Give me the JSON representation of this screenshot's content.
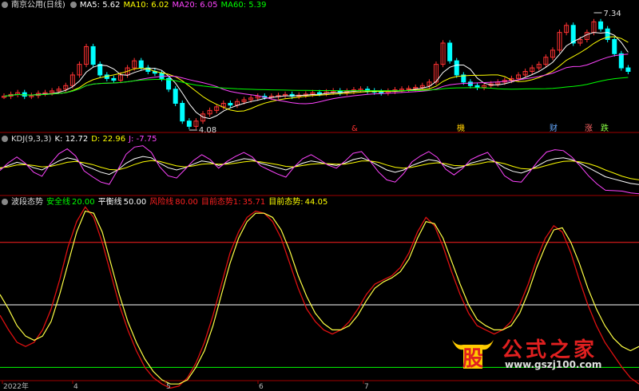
{
  "panel_main": {
    "title": "南京公用(日线)",
    "ma5": {
      "label": "MA5: 5.62",
      "color": "#ffffff"
    },
    "ma10": {
      "label": "MA10: 6.02",
      "color": "#ffff00"
    },
    "ma20": {
      "label": "MA20: 6.05",
      "color": "#ff44ff"
    },
    "ma60": {
      "label": "MA60: 5.39",
      "color": "#00ff00"
    },
    "high_label": "7.34",
    "low_label": "4.08",
    "markers": [
      {
        "text": "&",
        "color": "#ff3030",
        "pos": 0.55
      },
      {
        "text": "機",
        "color": "#ffcc00",
        "pos": 0.715
      },
      {
        "text": "财",
        "color": "#66aaff",
        "pos": 0.86
      },
      {
        "text": "涨",
        "color": "#ff6666",
        "pos": 0.915
      },
      {
        "text": "跌",
        "color": "#88ff44",
        "pos": 0.94
      }
    ]
  },
  "panel_kdj": {
    "title": "KDJ(9,3,3)",
    "k": {
      "label": "K: 12.72",
      "color": "#ffffff"
    },
    "d": {
      "label": "D: 22.96",
      "color": "#ffff00"
    },
    "j": {
      "label": "J: -7.75",
      "color": "#ff44ff"
    }
  },
  "panel_wave": {
    "title": "波段态势",
    "safe": {
      "label": "安全线",
      "value": "20.00",
      "color": "#00ff00"
    },
    "balance": {
      "label": "平衡线",
      "value": "50.00",
      "color": "#ffffff"
    },
    "risk": {
      "label": "风险线",
      "value": "80.00",
      "color": "#ff2020"
    },
    "state1": {
      "label": "目前态势1:",
      "value": "35.71",
      "color": "#ff2020"
    },
    "state": {
      "label": "目前态势:",
      "value": "44.05",
      "color": "#ffff00"
    }
  },
  "x_labels": [
    {
      "text": "2022年",
      "pos": 0.0
    },
    {
      "text": "4",
      "pos": 0.11
    },
    {
      "text": "5",
      "pos": 0.255
    },
    {
      "text": "6",
      "pos": 0.4
    },
    {
      "text": "7",
      "pos": 0.565
    }
  ],
  "watermark": {
    "glyph": "股",
    "text": "公式之家",
    "url": "www.gszj100.com"
  },
  "chart_data": [
    {
      "type": "candlestick",
      "title": "南京公用(日线)",
      "series": [
        {
          "name": "MA5",
          "values": []
        },
        {
          "name": "MA10",
          "values": []
        },
        {
          "name": "MA20",
          "values": []
        },
        {
          "name": "MA60",
          "values": []
        }
      ],
      "price_series": [
        5.0,
        5.05,
        5.1,
        5.0,
        5.02,
        5.08,
        5.1,
        5.15,
        5.2,
        5.3,
        5.6,
        5.9,
        6.4,
        5.9,
        5.6,
        5.5,
        5.45,
        5.6,
        5.8,
        6.0,
        5.8,
        5.7,
        5.65,
        5.5,
        5.2,
        4.8,
        4.3,
        4.15,
        4.3,
        4.5,
        4.6,
        4.7,
        4.8,
        4.75,
        4.85,
        4.9,
        4.95,
        5.0,
        4.98,
        5.0,
        5.02,
        5.05,
        5.0,
        5.03,
        5.06,
        5.1,
        5.08,
        5.12,
        5.15,
        5.1,
        5.14,
        5.18,
        5.2,
        5.15,
        5.12,
        5.1,
        5.14,
        5.18,
        5.2,
        5.22,
        5.25,
        5.3,
        5.4,
        5.9,
        6.5,
        6.0,
        5.6,
        5.4,
        5.3,
        5.25,
        5.3,
        5.35,
        5.4,
        5.45,
        5.5,
        5.6,
        5.7,
        5.8,
        5.9,
        6.1,
        6.3,
        6.8,
        7.0,
        6.5,
        6.6,
        6.8,
        7.1,
        6.9,
        6.6,
        6.2,
        5.8,
        5.7
      ],
      "ylim": [
        4.0,
        7.4
      ],
      "annotations": [
        "7.34",
        "4.08"
      ]
    },
    {
      "type": "line",
      "title": "KDJ(9,3,3)",
      "x": [],
      "series": [
        {
          "name": "K",
          "values": [
            48,
            55,
            62,
            58,
            50,
            45,
            55,
            65,
            72,
            68,
            55,
            48,
            40,
            35,
            45,
            60,
            70,
            75,
            72,
            60,
            50,
            45,
            50,
            58,
            65,
            62,
            55,
            60,
            65,
            70,
            68,
            60,
            55,
            50,
            45,
            52,
            60,
            65,
            62,
            58,
            55,
            60,
            68,
            72,
            65,
            55,
            45,
            40,
            45,
            55,
            62,
            68,
            65,
            55,
            48,
            52,
            60,
            65,
            70,
            62,
            50,
            42,
            38,
            45,
            55,
            65,
            70,
            72,
            68,
            60,
            50,
            40,
            30,
            25,
            20,
            15,
            12.72
          ]
        },
        {
          "name": "D",
          "values": [
            50,
            52,
            56,
            57,
            55,
            52,
            53,
            57,
            62,
            64,
            61,
            57,
            51,
            46,
            45,
            50,
            57,
            63,
            66,
            64,
            59,
            54,
            52,
            54,
            58,
            59,
            58,
            58,
            60,
            63,
            65,
            63,
            60,
            57,
            53,
            52,
            55,
            58,
            59,
            59,
            58,
            58,
            61,
            65,
            65,
            62,
            56,
            51,
            49,
            51,
            55,
            59,
            61,
            59,
            55,
            54,
            56,
            59,
            63,
            63,
            59,
            53,
            48,
            47,
            50,
            55,
            60,
            64,
            65,
            63,
            59,
            53,
            45,
            38,
            31,
            26,
            22.96
          ]
        },
        {
          "name": "J",
          "values": [
            44,
            61,
            74,
            60,
            40,
            31,
            59,
            81,
            92,
            76,
            43,
            30,
            18,
            13,
            45,
            80,
            96,
            99,
            84,
            52,
            32,
            27,
            46,
            66,
            79,
            68,
            49,
            64,
            75,
            84,
            74,
            54,
            45,
            36,
            29,
            52,
            70,
            79,
            68,
            56,
            49,
            64,
            82,
            86,
            65,
            41,
            23,
            18,
            37,
            63,
            76,
            86,
            73,
            47,
            34,
            48,
            68,
            77,
            84,
            60,
            32,
            20,
            18,
            41,
            65,
            85,
            90,
            88,
            74,
            54,
            32,
            14,
            0,
            -1,
            -2,
            -6,
            -7.75
          ]
        }
      ]
    },
    {
      "type": "line",
      "title": "波段态势",
      "series": [
        {
          "name": "目前态势1",
          "values": [
            45,
            38,
            32,
            30,
            32,
            38,
            48,
            62,
            78,
            90,
            97,
            92,
            80,
            65,
            50,
            38,
            28,
            20,
            15,
            12,
            10,
            11,
            15,
            22,
            32,
            45,
            60,
            75,
            85,
            92,
            95,
            94,
            90,
            82,
            70,
            58,
            48,
            42,
            38,
            36,
            38,
            42,
            48,
            55,
            60,
            62,
            64,
            68,
            75,
            85,
            92,
            88,
            78,
            66,
            55,
            46,
            40,
            38,
            36,
            38,
            42,
            50,
            60,
            72,
            82,
            88,
            85,
            75,
            62,
            50,
            40,
            32,
            26,
            20,
            15,
            12
          ]
        },
        {
          "name": "目前态势",
          "values": [
            55,
            48,
            40,
            35,
            33,
            35,
            42,
            55,
            70,
            85,
            95,
            94,
            85,
            70,
            55,
            42,
            32,
            24,
            18,
            14,
            12,
            12,
            14,
            20,
            28,
            40,
            55,
            70,
            82,
            90,
            94,
            94,
            92,
            86,
            76,
            64,
            54,
            46,
            41,
            38,
            38,
            40,
            45,
            52,
            58,
            61,
            63,
            66,
            72,
            82,
            90,
            89,
            82,
            71,
            60,
            50,
            43,
            40,
            38,
            38,
            40,
            46,
            56,
            68,
            78,
            86,
            87,
            80,
            70,
            58,
            48,
            40,
            34,
            30,
            28,
            30
          ]
        }
      ],
      "ylim": [
        14,
        96
      ],
      "hlines": [
        20,
        50,
        80
      ]
    }
  ]
}
